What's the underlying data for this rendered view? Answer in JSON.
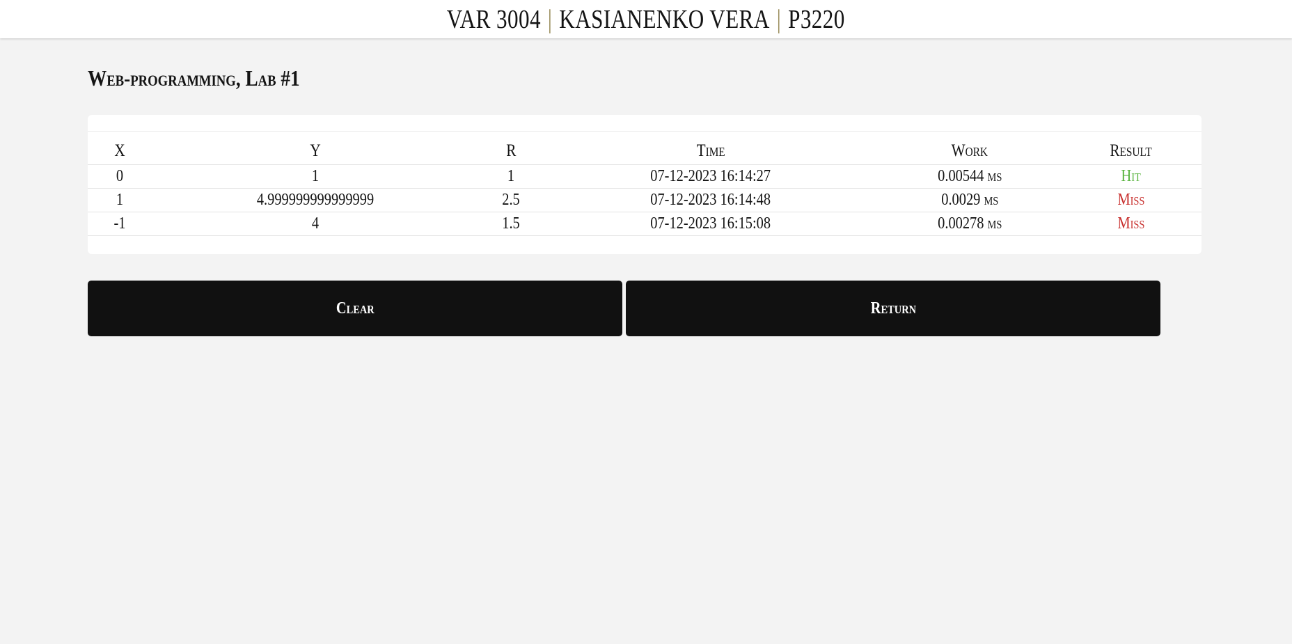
{
  "header": {
    "variant": "VAR 3004",
    "separator": "|",
    "author": "KASIANENKO VERA",
    "group": "P3220"
  },
  "page": {
    "heading": "Web-programming, Lab #1"
  },
  "table": {
    "columns": [
      "X",
      "Y",
      "R",
      "Time",
      "Work",
      "Result"
    ],
    "rows": [
      {
        "x": "0",
        "y": "1",
        "r": "1",
        "time": "07-12-2023 16:14:27",
        "work": "0.00544",
        "unit": "ms",
        "result": "Hit"
      },
      {
        "x": "1",
        "y": "4.999999999999999",
        "r": "2.5",
        "time": "07-12-2023 16:14:48",
        "work": "0.0029",
        "unit": "ms",
        "result": "Miss"
      },
      {
        "x": "-1",
        "y": "4",
        "r": "1.5",
        "time": "07-12-2023 16:15:08",
        "work": "0.00278",
        "unit": "ms",
        "result": "Miss"
      }
    ]
  },
  "buttons": {
    "clear_label": "Clear",
    "return_label": "Return"
  },
  "colors": {
    "hit": "#57b33c",
    "miss": "#c8302e",
    "separator": "#9c8f5e",
    "button_bg": "#111111"
  }
}
